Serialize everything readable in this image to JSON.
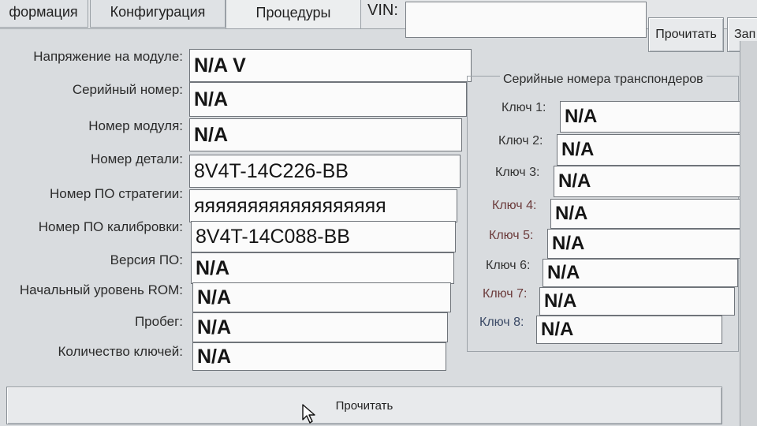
{
  "tabs": [
    {
      "label": "формация"
    },
    {
      "label": "Конфигурация"
    },
    {
      "label": "Процедуры"
    }
  ],
  "vin": {
    "label": "VIN:",
    "value": ""
  },
  "top_buttons": {
    "read": "Прочитать",
    "write": "Зап"
  },
  "module_info": [
    {
      "label": "Напряжение на модуле:",
      "value": "N/A V",
      "bold": true
    },
    {
      "label": "Серийный номер:",
      "value": "N/A",
      "bold": true
    },
    {
      "label": "Номер модуля:",
      "value": "N/A",
      "bold": true
    },
    {
      "label": "Номер детали:",
      "value": "8V4T-14C226-BB",
      "bold": false
    },
    {
      "label": "Номер ПО стратегии:",
      "value": "яяяяяяяяяяяяяяяяяя",
      "bold": false
    },
    {
      "label": "Номер ПО калибровки:",
      "value": "8V4T-14C088-BB",
      "bold": false
    },
    {
      "label": "Версия ПО:",
      "value": "N/A",
      "bold": true
    },
    {
      "label": "Начальный уровень ROM:",
      "value": "N/A",
      "bold": true
    },
    {
      "label": "Пробег:",
      "value": "N/A",
      "bold": true
    },
    {
      "label": "Количество ключей:",
      "value": "N/A",
      "bold": true
    }
  ],
  "transponders": {
    "title": "Серийные номера транспондеров",
    "keys": [
      {
        "label": "Ключ 1:",
        "value": "N/A"
      },
      {
        "label": "Ключ 2:",
        "value": "N/A"
      },
      {
        "label": "Ключ 3:",
        "value": "N/A"
      },
      {
        "label": "Ключ 4:",
        "value": "N/A"
      },
      {
        "label": "Ключ 5:",
        "value": "N/A"
      },
      {
        "label": "Ключ 6:",
        "value": "N/A"
      },
      {
        "label": "Ключ 7:",
        "value": "N/A"
      },
      {
        "label": "Ключ 8:",
        "value": "N/A"
      }
    ]
  },
  "bottom_button": {
    "label": "Прочитать"
  }
}
